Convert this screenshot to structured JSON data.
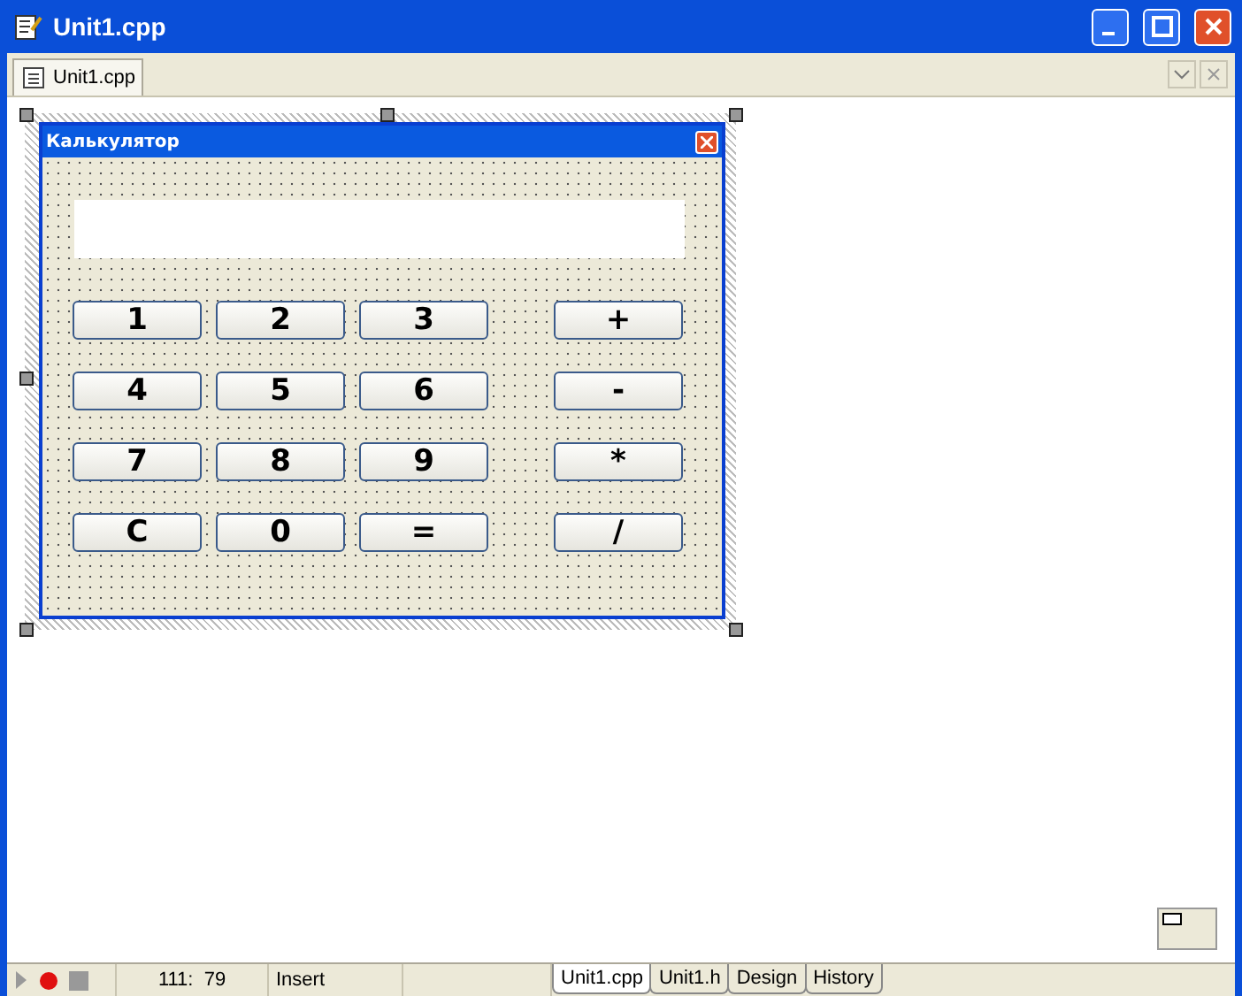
{
  "window": {
    "title": "Unit1.cpp"
  },
  "file_tabs": [
    {
      "label": "Unit1.cpp",
      "selected": true
    }
  ],
  "form": {
    "title": "Калькулятор",
    "buttons": [
      [
        "1",
        "2",
        "3",
        "+"
      ],
      [
        "4",
        "5",
        "6",
        "-"
      ],
      [
        "7",
        "8",
        "9",
        "*"
      ],
      [
        "C",
        "0",
        "=",
        "/"
      ]
    ]
  },
  "status_bar": {
    "position": "111:  79",
    "mode": "Insert"
  },
  "view_tabs": [
    {
      "label": "Unit1.cpp",
      "selected": true
    },
    {
      "label": "Unit1.h",
      "selected": false
    },
    {
      "label": "Design",
      "selected": false
    },
    {
      "label": "History",
      "selected": false
    }
  ]
}
